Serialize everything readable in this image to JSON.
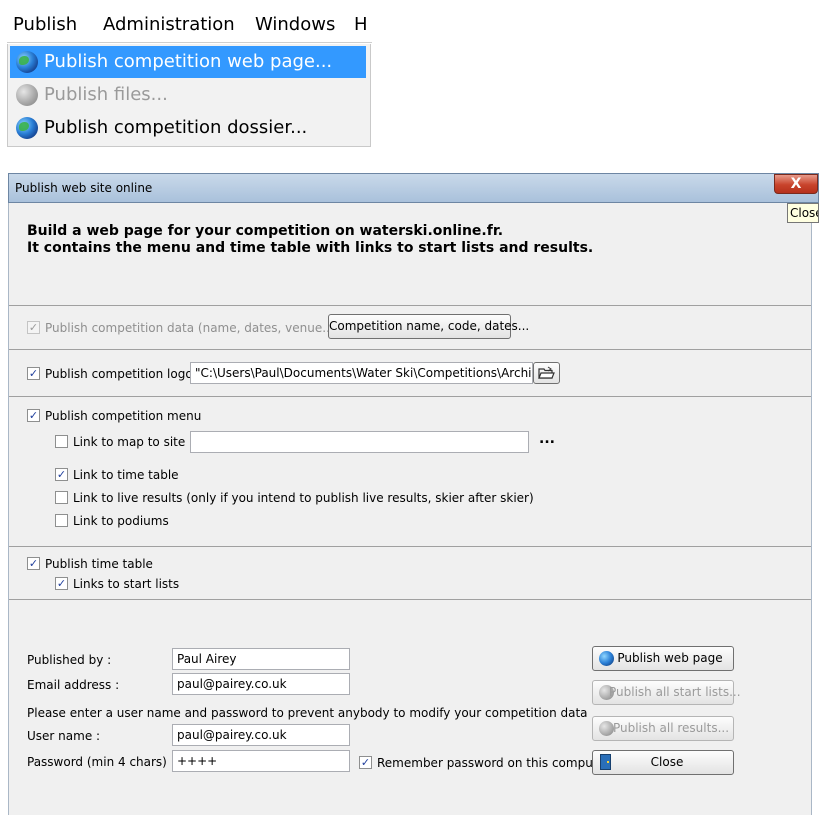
{
  "menubar": {
    "items": [
      "Publish",
      "Administration",
      "Windows",
      "H"
    ]
  },
  "dropdown": {
    "items": [
      {
        "label": "Publish competition web page...",
        "state": "selected",
        "icon": "globe-icon"
      },
      {
        "label": "Publish files...",
        "state": "disabled",
        "icon": "globe-icon-grey"
      },
      {
        "label": "Publish competition dossier...",
        "state": "normal",
        "icon": "globe-icon"
      }
    ]
  },
  "dialog": {
    "title": "Publish web site online",
    "close_glyph": "X",
    "close_tooltip": "Close",
    "header": {
      "line1": "Build a web page for your competition on waterski.online.fr.",
      "line2": "It contains the menu and time table with links to start lists and results."
    },
    "data_section": {
      "checkbox_label": "Publish competition data (name, dates, venue...)",
      "checked": true,
      "button_label": "Competition name, code, dates..."
    },
    "logo_section": {
      "checkbox_label": "Publish competition logo :",
      "checked": true,
      "path_value": "\"C:\\Users\\Paul\\Documents\\Water Ski\\Competitions\\Archive\\",
      "browse_icon": "folder-open-icon"
    },
    "menu_section": {
      "checkbox_label": "Publish competition menu",
      "checked": true,
      "map_label": "Link to map to site :",
      "map_checked": false,
      "map_value": "",
      "map_more": "...",
      "timetable_label": "Link to time table",
      "timetable_checked": true,
      "live_label": "Link to live results  (only if you intend to publish live results, skier after skier)",
      "live_checked": false,
      "podiums_label": "Link to podiums",
      "podiums_checked": false
    },
    "timetable_section": {
      "checkbox_label": "Publish time table",
      "checked": true,
      "startlists_label": "Links to start lists",
      "startlists_checked": true
    },
    "form": {
      "published_by_label": "Published by :",
      "published_by_value": "Paul Airey",
      "email_label": "Email address :",
      "email_value": "paul@pairey.co.uk",
      "info_text": "Please enter a user name and password to prevent anybody to modify your competition data",
      "username_label": "User name :",
      "username_value": "paul@pairey.co.uk",
      "password_label": "Password (min 4 chars) :",
      "password_value": "++++",
      "remember_label": "Remember password on this computer",
      "remember_checked": true,
      "publish_web_page_label": "Publish web page",
      "publish_start_lists_label": "Publish all start lists...",
      "publish_results_label": "Publish all results...",
      "close_label": "Close"
    }
  }
}
